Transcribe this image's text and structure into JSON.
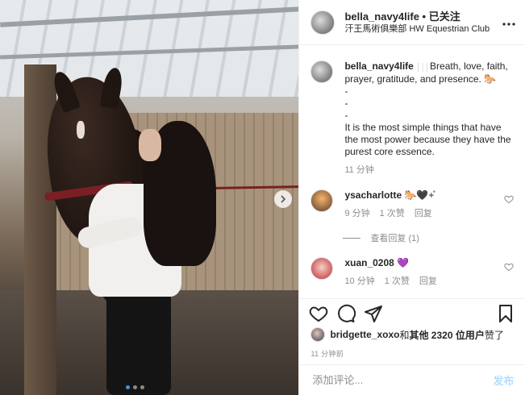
{
  "header": {
    "username": "bella_navy4life",
    "separator": " • ",
    "follow_label": "已关注",
    "location": "汗王馬術俱樂部 HW Equestrian Club",
    "more_icon": "more-horizontal-icon"
  },
  "caption": {
    "username": "bella_navy4life",
    "text_line1": "Breath, love, faith, prayer, gratitude, and presence. 🐎",
    "dash1": "-",
    "dash2": "-",
    "dash3": "-",
    "text_line2": "It is the most simple things that have the most power because they have the purest core essence.",
    "time": "11 分钟"
  },
  "comments": [
    {
      "username": "ysacharlotte",
      "text": "🐎🖤+̊",
      "time": "9 分钟",
      "likes": "1 次赞",
      "reply_label": "回复",
      "view_replies": "查看回复 (1)"
    },
    {
      "username": "xuan_0208",
      "text": "💜",
      "time": "10 分钟",
      "likes": "1 次赞",
      "reply_label": "回复"
    }
  ],
  "likes": {
    "user": "bridgette_xoxo",
    "and": " 和 ",
    "others": "其他 2320 位用户",
    "suffix": " 赞了"
  },
  "timestamp": "11 分钟前",
  "add_comment": {
    "placeholder": "添加评论...",
    "post_label": "发布"
  },
  "carousel": {
    "slides": 3,
    "active": 1
  },
  "colors": {
    "accent": "#3897f0",
    "post_disabled": "#b2dffc",
    "muted": "#8e8e8e"
  }
}
